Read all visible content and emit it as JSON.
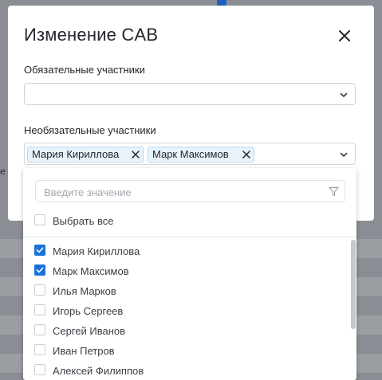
{
  "dialog": {
    "title": "Изменение CAB",
    "required_label": "Обязательные участники",
    "required_value": "",
    "optional_label": "Необязательные участники",
    "optional_chips": [
      "Мария Кириллова",
      "Марк Максимов"
    ]
  },
  "dropdown": {
    "search_placeholder": "Введите значение",
    "select_all_label": "Выбрать все",
    "select_all_checked": false,
    "options": [
      {
        "label": "Мария Кириллова",
        "checked": true
      },
      {
        "label": "Марк Максимов",
        "checked": true
      },
      {
        "label": "Илья Марков",
        "checked": false
      },
      {
        "label": "Игорь Сергеев",
        "checked": false
      },
      {
        "label": "Сергей Иванов",
        "checked": false
      },
      {
        "label": "Иван Петров",
        "checked": false
      },
      {
        "label": "Алексей Филиппов",
        "checked": false
      }
    ]
  },
  "background": {
    "hint_text": "е"
  },
  "colors": {
    "accent": "#1a73d9",
    "chip_bg": "#e9f3fb",
    "chip_border": "#b9d7ee"
  },
  "icons": {
    "close": "close-icon",
    "chevron": "chevron-down-icon",
    "chip_remove": "close-small-icon",
    "filter": "filter-icon",
    "check": "check-icon"
  }
}
